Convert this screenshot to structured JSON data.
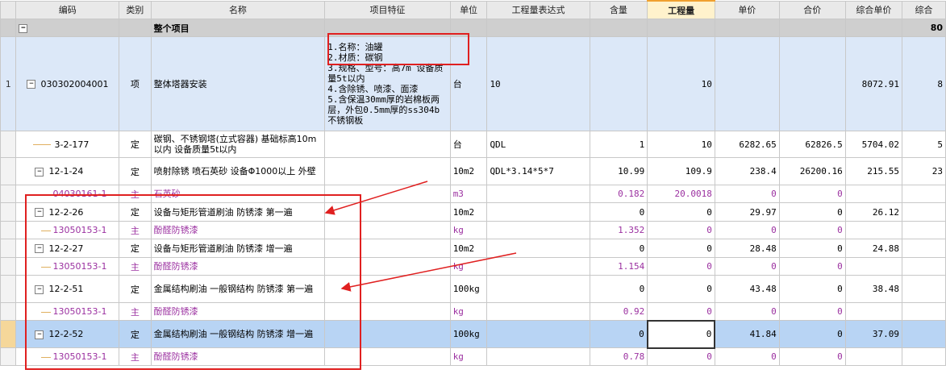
{
  "headers": [
    "编码",
    "类别",
    "名称",
    "项目特征",
    "单位",
    "工程量表达式",
    "含量",
    "工程量",
    "单价",
    "合价",
    "综合单价",
    "综合"
  ],
  "group": {
    "label": "整个项目",
    "right_value": "80"
  },
  "main": {
    "index": "1",
    "code": "030302004001",
    "type": "项",
    "name": "整体塔器安装",
    "feature_lines": [
      "1.名称：油罐",
      "2.材质：碳钢",
      "3.规格、型号：高7m 设备质量5t以内",
      "4.含除锈、喷漆、面漆",
      "5.含保温30mm厚的岩棉板两层，外包0.5mm厚的ss304b不锈钢板"
    ],
    "unit": "台",
    "expr": "10",
    "qty": "10",
    "comp_price": "8072.91",
    "last": "8"
  },
  "rows": [
    {
      "kind": "def",
      "code": "3-2-177",
      "type": "定",
      "name": "碳钢、不锈钢塔(立式容器) 基础标高10m以内 设备质量5t以内",
      "unit": "台",
      "expr": "QDL",
      "content": "1",
      "qty": "10",
      "price": "6282.65",
      "total": "62826.5",
      "comp": "5704.02",
      "last": "5"
    },
    {
      "kind": "def",
      "code": "12-1-24",
      "type": "定",
      "name": "喷射除锈 喷石英砂 设备Φ1000以上 外壁",
      "unit": "10m2",
      "expr": "QDL*3.14*5*7",
      "content": "10.99",
      "qty": "109.9",
      "price": "238.4",
      "total": "26200.16",
      "comp": "215.55",
      "last": "23"
    },
    {
      "kind": "sub",
      "code": "04030161-1",
      "type": "主",
      "name": "石英砂",
      "unit": "m3",
      "expr": "",
      "content": "0.182",
      "qty": "20.0018",
      "price": "0",
      "total": "0",
      "comp": "",
      "last": ""
    },
    {
      "kind": "def",
      "code": "12-2-26",
      "type": "定",
      "name": "设备与矩形管道刷油 防锈漆 第一遍",
      "unit": "10m2",
      "expr": "",
      "content": "0",
      "qty": "0",
      "price": "29.97",
      "total": "0",
      "comp": "26.12",
      "last": ""
    },
    {
      "kind": "sub",
      "code": "13050153-1",
      "type": "主",
      "name": "酚醛防锈漆",
      "unit": "kg",
      "expr": "",
      "content": "1.352",
      "qty": "0",
      "price": "0",
      "total": "0",
      "comp": "",
      "last": ""
    },
    {
      "kind": "def",
      "code": "12-2-27",
      "type": "定",
      "name": "设备与矩形管道刷油 防锈漆 增一遍",
      "unit": "10m2",
      "expr": "",
      "content": "0",
      "qty": "0",
      "price": "28.48",
      "total": "0",
      "comp": "24.88",
      "last": ""
    },
    {
      "kind": "sub",
      "code": "13050153-1",
      "type": "主",
      "name": "酚醛防锈漆",
      "unit": "kg",
      "expr": "",
      "content": "1.154",
      "qty": "0",
      "price": "0",
      "total": "0",
      "comp": "",
      "last": ""
    },
    {
      "kind": "def",
      "code": "12-2-51",
      "type": "定",
      "name": "金属结构刷油 一般钢结构 防锈漆 第一遍",
      "unit": "100kg",
      "expr": "",
      "content": "0",
      "qty": "0",
      "price": "43.48",
      "total": "0",
      "comp": "38.48",
      "last": ""
    },
    {
      "kind": "sub",
      "code": "13050153-1",
      "type": "主",
      "name": "酚醛防锈漆",
      "unit": "kg",
      "expr": "",
      "content": "0.92",
      "qty": "0",
      "price": "0",
      "total": "0",
      "comp": "",
      "last": ""
    },
    {
      "kind": "def",
      "code": "12-2-52",
      "type": "定",
      "name": "金属结构刷油 一般钢结构 防锈漆 增一遍",
      "unit": "100kg",
      "expr": "",
      "content": "0",
      "qty": "0",
      "price": "41.84",
      "total": "0",
      "comp": "37.09",
      "last": "",
      "selected": true
    },
    {
      "kind": "sub",
      "code": "13050153-1",
      "type": "主",
      "name": "酚醛防锈漆",
      "unit": "kg",
      "expr": "",
      "content": "0.78",
      "qty": "0",
      "price": "0",
      "total": "0",
      "comp": "",
      "last": ""
    }
  ],
  "colors": {
    "annotation": "#e02020",
    "group_bg": "#cfcfcf",
    "main_bg": "#dce8f8",
    "selected_bg": "#b8d4f4",
    "sub_text": "#9b30a0"
  },
  "icons": {
    "expand": "minus-box-icon"
  }
}
